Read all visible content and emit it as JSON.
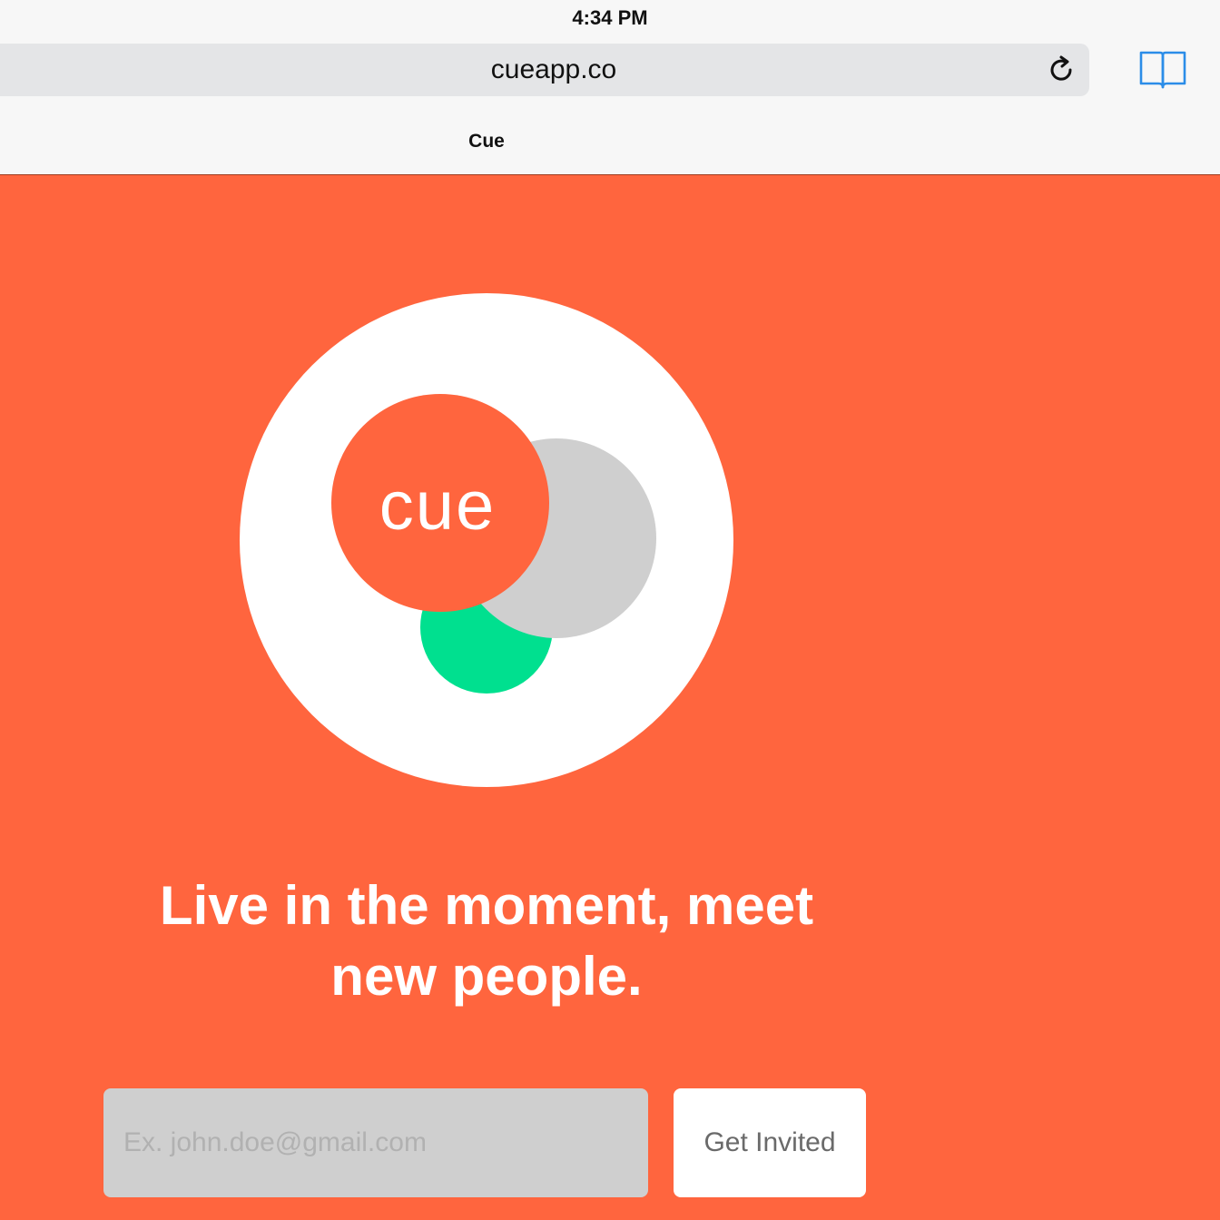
{
  "status_bar": {
    "time": "4:34 PM"
  },
  "browser": {
    "url": "cueapp.co",
    "tab_title": "Cue",
    "reload_icon": "reload-icon",
    "bookmarks_icon": "bookmarks-book-icon"
  },
  "page": {
    "logo_text": "cue",
    "headline_line1": "Live in the moment, meet",
    "headline_line2": "new people.",
    "email_placeholder": "Ex. john.doe@gmail.com",
    "email_value": "",
    "cta_label": "Get Invited"
  },
  "colors": {
    "brand_orange": "#ff653e",
    "logo_gray": "#cfcfcf",
    "logo_green": "#00e08f",
    "safari_blue": "#2b8de8"
  }
}
